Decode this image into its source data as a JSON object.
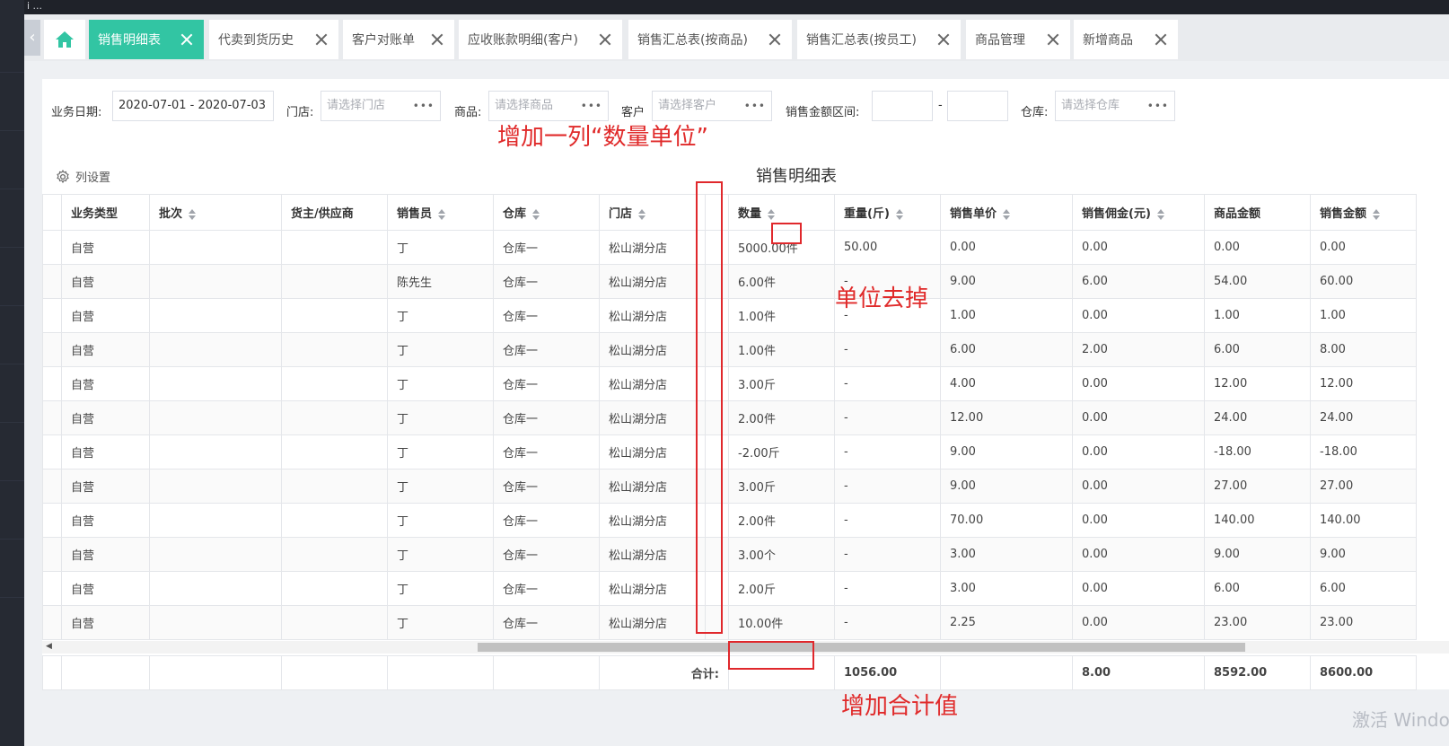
{
  "topbar": {
    "corner_text": "i ..."
  },
  "tabs": [
    {
      "label": "销售明细表",
      "active": true
    },
    {
      "label": "代卖到货历史"
    },
    {
      "label": "客户对账单"
    },
    {
      "label": "应收账款明细(客户)"
    },
    {
      "label": "销售汇总表(按商品)"
    },
    {
      "label": "销售汇总表(按员工)"
    },
    {
      "label": "商品管理"
    },
    {
      "label": "新增商品"
    }
  ],
  "filters": {
    "date_label": "业务日期:",
    "date_value": "2020-07-01 - 2020-07-03",
    "store_label": "门店:",
    "store_placeholder": "请选择门店",
    "product_label": "商品:",
    "product_placeholder": "请选择商品",
    "customer_label": "客户",
    "customer_placeholder": "请选择客户",
    "amount_label": "销售金额区间:",
    "amount_sep": "-",
    "warehouse_label": "仓库:",
    "warehouse_placeholder": "请选择仓库"
  },
  "toolbar": {
    "column_settings": "列设置"
  },
  "report_title": "销售明细表",
  "columns": [
    "业务类型",
    "批次",
    "货主/供应商",
    "销售员",
    "仓库",
    "门店",
    "",
    "数量",
    "重量(斤)",
    "销售单价",
    "销售佣金(元)",
    "商品金额",
    "销售金额"
  ],
  "rows": [
    [
      "自营",
      "",
      "",
      "丁",
      "仓库一",
      "松山湖分店",
      "",
      "5000.00件",
      "50.00",
      "0.00",
      "0.00",
      "0.00",
      "0.00"
    ],
    [
      "自营",
      "",
      "",
      "陈先生",
      "仓库一",
      "松山湖分店",
      "",
      "6.00件",
      "-",
      "9.00",
      "6.00",
      "54.00",
      "60.00"
    ],
    [
      "自营",
      "",
      "",
      "丁",
      "仓库一",
      "松山湖分店",
      "",
      "1.00件",
      "-",
      "1.00",
      "0.00",
      "1.00",
      "1.00"
    ],
    [
      "自营",
      "",
      "",
      "丁",
      "仓库一",
      "松山湖分店",
      "",
      "1.00件",
      "-",
      "6.00",
      "2.00",
      "6.00",
      "8.00"
    ],
    [
      "自营",
      "",
      "",
      "丁",
      "仓库一",
      "松山湖分店",
      "",
      "3.00斤",
      "-",
      "4.00",
      "0.00",
      "12.00",
      "12.00"
    ],
    [
      "自营",
      "",
      "",
      "丁",
      "仓库一",
      "松山湖分店",
      "",
      "2.00件",
      "-",
      "12.00",
      "0.00",
      "24.00",
      "24.00"
    ],
    [
      "自营",
      "",
      "",
      "丁",
      "仓库一",
      "松山湖分店",
      "",
      "-2.00斤",
      "-",
      "9.00",
      "0.00",
      "-18.00",
      "-18.00"
    ],
    [
      "自营",
      "",
      "",
      "丁",
      "仓库一",
      "松山湖分店",
      "",
      "3.00斤",
      "-",
      "9.00",
      "0.00",
      "27.00",
      "27.00"
    ],
    [
      "自营",
      "",
      "",
      "丁",
      "仓库一",
      "松山湖分店",
      "",
      "2.00件",
      "-",
      "70.00",
      "0.00",
      "140.00",
      "140.00"
    ],
    [
      "自营",
      "",
      "",
      "丁",
      "仓库一",
      "松山湖分店",
      "",
      "3.00个",
      "-",
      "3.00",
      "0.00",
      "9.00",
      "9.00"
    ],
    [
      "自营",
      "",
      "",
      "丁",
      "仓库一",
      "松山湖分店",
      "",
      "2.00斤",
      "-",
      "3.00",
      "0.00",
      "6.00",
      "6.00"
    ],
    [
      "自营",
      "",
      "",
      "丁",
      "仓库一",
      "松山湖分店",
      "",
      "10.00件",
      "-",
      "2.25",
      "0.00",
      "23.00",
      "23.00"
    ]
  ],
  "totals": {
    "label": "合计:",
    "quantity": "",
    "weight": "1056.00",
    "commission": "8.00",
    "product_amount": "8592.00",
    "sales_amount": "8600.00"
  },
  "annotations": {
    "add_column": "增加一列“数量单位”",
    "remove_unit": "单位去掉",
    "add_total": "增加合计值",
    "color": "#e02a2a"
  },
  "watermark": "激活 Windo",
  "colors": {
    "accent": "#32c5a3",
    "annotation": "#e02a2a"
  }
}
